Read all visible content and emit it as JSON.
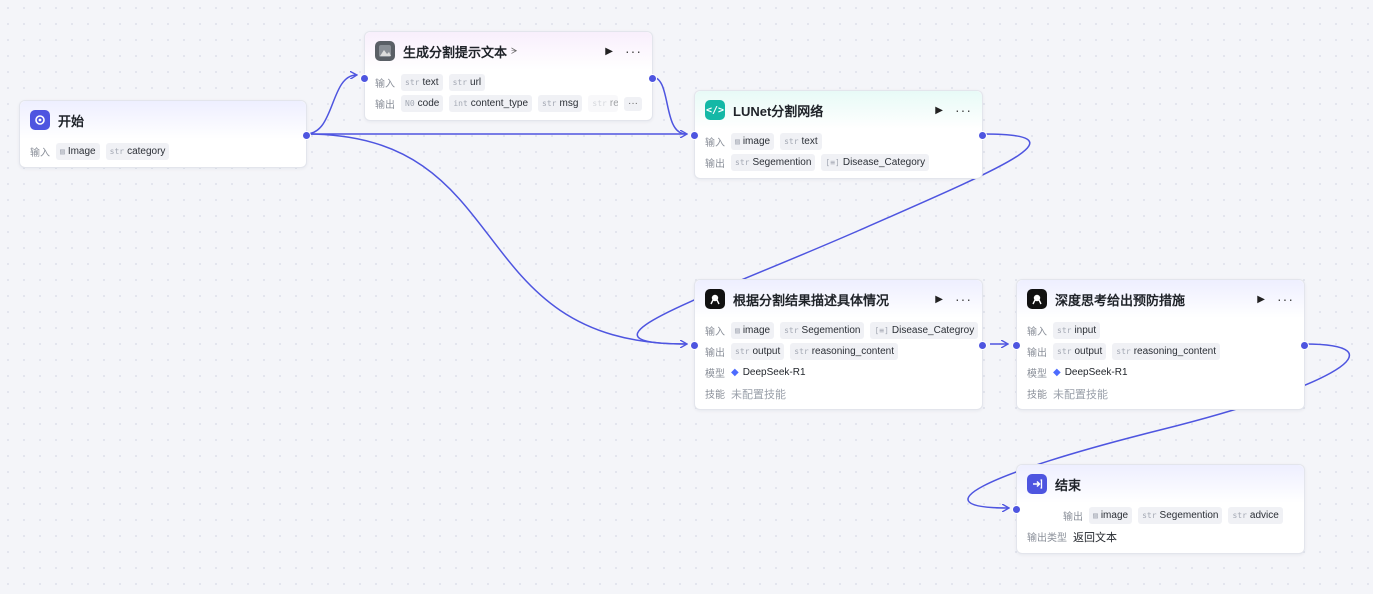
{
  "labels": {
    "input": "输入",
    "output": "输出",
    "model": "模型",
    "skill": "技能",
    "output_type": "输出类型",
    "run_icon": "▶",
    "more_icon": "···"
  },
  "colors": {
    "accent": "#4e55e0",
    "edge": "#4e55e0",
    "code_icon": "#14b8a6",
    "llm_icon": "#111111"
  },
  "nodes": {
    "start": {
      "title": "开始",
      "icon": "start-icon",
      "inputs": [
        {
          "type": "img",
          "name": "Image"
        },
        {
          "type": "str",
          "name": "category"
        }
      ]
    },
    "prompt": {
      "title": "生成分割提示文本",
      "icon": "image-plugin-icon",
      "badge": "ᗒ",
      "inputs": [
        {
          "type": "str",
          "name": "text"
        },
        {
          "type": "str",
          "name": "url"
        }
      ],
      "outputs": [
        {
          "type": "N0",
          "name": "code"
        },
        {
          "type": "int",
          "name": "content_type"
        },
        {
          "type": "str",
          "name": "msg"
        },
        {
          "type": "str",
          "name": "res"
        }
      ],
      "more": "···"
    },
    "lunet": {
      "title": "LUNet分割网络",
      "icon": "code-icon",
      "inputs": [
        {
          "type": "img",
          "name": "image"
        },
        {
          "type": "str",
          "name": "text"
        }
      ],
      "outputs": [
        {
          "type": "str",
          "name": "Segemention"
        },
        {
          "type": "arr",
          "name": "Disease_Category"
        }
      ]
    },
    "describe": {
      "title": "根据分割结果描述具体情况",
      "icon": "llm-icon",
      "inputs": [
        {
          "type": "img",
          "name": "image"
        },
        {
          "type": "str",
          "name": "Segemention"
        },
        {
          "type": "arr",
          "name": "Disease_Categroy"
        }
      ],
      "outputs": [
        {
          "type": "str",
          "name": "output"
        },
        {
          "type": "str",
          "name": "reasoning_content"
        }
      ],
      "model": "DeepSeek-R1",
      "skill": "未配置技能"
    },
    "prevent": {
      "title": "深度思考给出预防措施",
      "icon": "llm-icon",
      "inputs": [
        {
          "type": "str",
          "name": "input"
        }
      ],
      "outputs": [
        {
          "type": "str",
          "name": "output"
        },
        {
          "type": "str",
          "name": "reasoning_content"
        }
      ],
      "model": "DeepSeek-R1",
      "skill": "未配置技能"
    },
    "end": {
      "title": "结束",
      "icon": "end-icon",
      "outputs": [
        {
          "type": "img",
          "name": "image"
        },
        {
          "type": "str",
          "name": "Segemention"
        },
        {
          "type": "str",
          "name": "advice"
        }
      ],
      "output_type": "返回文本"
    }
  }
}
